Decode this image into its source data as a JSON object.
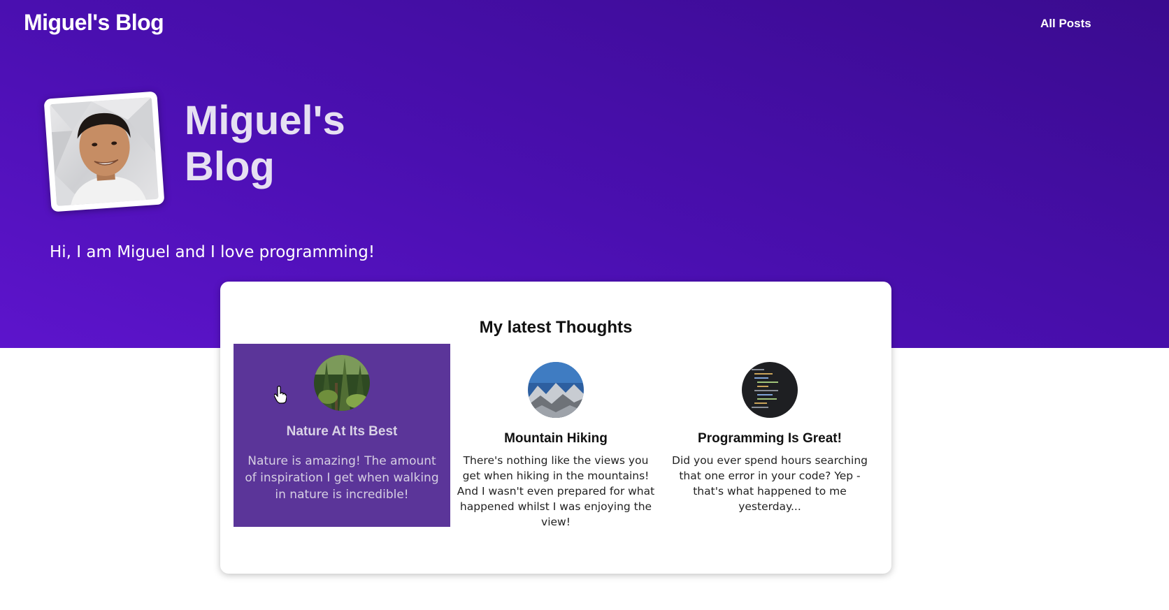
{
  "nav": {
    "logo": "Miguel's Blog",
    "all_posts": "All Posts"
  },
  "hero": {
    "title": "Miguel's Blog",
    "intro": "Hi, I am Miguel and I love programming!",
    "avatar_alt": "Miguel avatar"
  },
  "colors": {
    "hero_start": "#5d14cc",
    "hero_end": "#3a0b8f",
    "active_post": "#5b3599"
  },
  "latest": {
    "title": "My latest Thoughts",
    "posts": [
      {
        "title": "Nature At Its Best",
        "excerpt": "Nature is amazing! The amount of inspiration I get when walking in nature is incredible!",
        "thumb": "forest-image"
      },
      {
        "title": "Mountain Hiking",
        "excerpt": "There's nothing like the views you get when hiking in the mountains! And I wasn't even prepared for what happened whilst I was enjoying the view!",
        "thumb": "mountain-image"
      },
      {
        "title": "Programming Is Great!",
        "excerpt": "Did you ever spend hours searching that one error in your code? Yep - that's what happened to me yesterday...",
        "thumb": "code-image"
      }
    ]
  }
}
